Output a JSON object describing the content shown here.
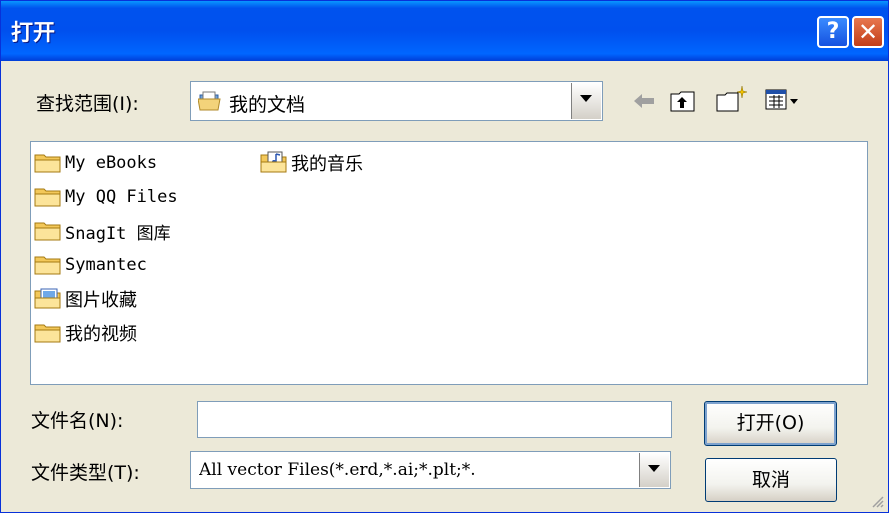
{
  "window": {
    "title": "打开"
  },
  "titlebar_buttons": {
    "help": "?",
    "close": "✕"
  },
  "look_in": {
    "label": "查找范围(I):",
    "value": "我的文档",
    "folder_icon": "my-documents-icon"
  },
  "toolbar_icons": [
    "back-arrow-icon",
    "up-folder-icon",
    "new-folder-icon",
    "views-menu-icon"
  ],
  "files": [
    {
      "name": "My eBooks",
      "icon": "folder-icon"
    },
    {
      "name": "My QQ Files",
      "icon": "folder-icon"
    },
    {
      "name": "SnagIt 图库",
      "icon": "folder-icon"
    },
    {
      "name": "Symantec",
      "icon": "folder-icon"
    },
    {
      "name": "图片收藏",
      "icon": "pictures-folder-icon"
    },
    {
      "name": "我的视频",
      "icon": "folder-icon"
    },
    {
      "name": "我的音乐",
      "icon": "music-folder-icon"
    }
  ],
  "file_name": {
    "label": "文件名(N):",
    "value": ""
  },
  "file_type": {
    "label": "文件类型(T):",
    "value": "All vector Files(*.erd,*.ai;*.plt;*."
  },
  "buttons": {
    "open": "打开(O)",
    "cancel": "取消"
  }
}
